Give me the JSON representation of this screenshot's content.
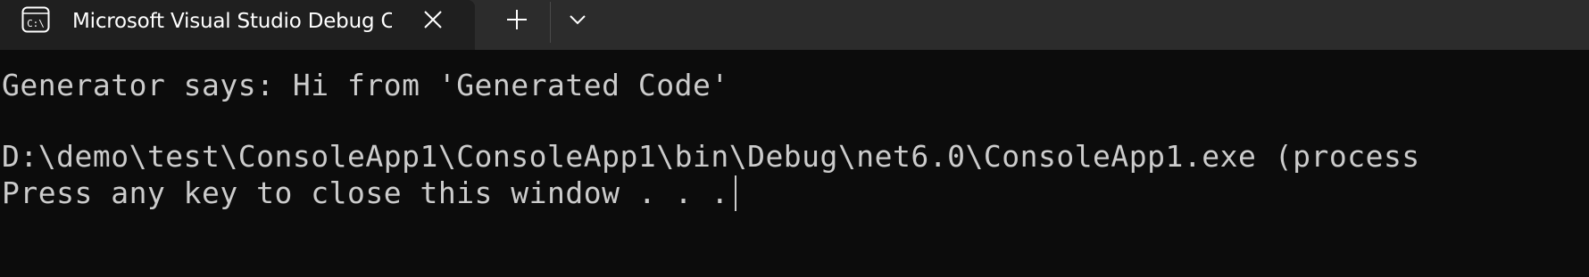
{
  "tab": {
    "title": "Microsoft Visual Studio Debug Console",
    "icon": "console-icon",
    "icon_text": "C:\\"
  },
  "tabbar": {
    "new_tab_icon": "plus-icon",
    "dropdown_icon": "chevron-down-icon",
    "close_icon": "close-icon"
  },
  "console": {
    "lines": [
      "Generator says: Hi from 'Generated Code'",
      "",
      "D:\\demo\\test\\ConsoleApp1\\ConsoleApp1\\bin\\Debug\\net6.0\\ConsoleApp1.exe (process",
      "Press any key to close this window . . ."
    ]
  },
  "colors": {
    "titlebar_bg": "#2c2c2c",
    "tab_bg": "#1f1f1f",
    "console_bg": "#0c0c0c",
    "console_text": "#cccccc"
  }
}
